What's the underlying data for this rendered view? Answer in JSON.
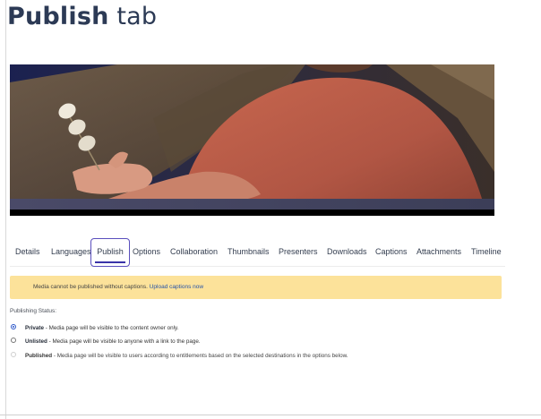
{
  "page": {
    "heading_bold": "Publish",
    "heading_rest": " tab"
  },
  "video": {
    "description_icon": "video-thumbnail"
  },
  "tabs": [
    {
      "label": "Details",
      "active": false
    },
    {
      "label": "Languages",
      "active": false
    },
    {
      "label": "Publish",
      "active": true
    },
    {
      "label": "Options",
      "active": false
    },
    {
      "label": "Collaboration",
      "active": false
    },
    {
      "label": "Thumbnails",
      "active": false
    },
    {
      "label": "Presenters",
      "active": false
    },
    {
      "label": "Downloads",
      "active": false
    },
    {
      "label": "Captions",
      "active": false
    },
    {
      "label": "Attachments",
      "active": false
    },
    {
      "label": "Timeline",
      "active": false
    }
  ],
  "alert": {
    "message": "Media cannot be published without captions.",
    "link_text": "Upload captions now",
    "color": "#fce29a"
  },
  "publishing": {
    "label": "Publishing Status:",
    "options": [
      {
        "name": "Private",
        "description": " - Media page will be visible to the content owner only.",
        "checked": true,
        "disabled": false
      },
      {
        "name": "Unlisted",
        "description": " - Media page will be visible to anyone with a link to the page.",
        "checked": false,
        "disabled": false
      },
      {
        "name": "Published",
        "description": " - Media page will be visible to users according to entitlements based on the selected destinations in the options below.",
        "checked": false,
        "disabled": true
      }
    ]
  },
  "colors": {
    "heading": "#2c3a55",
    "active_tab_border": "#5a4fbd",
    "radio_checked": "#2c57c9"
  }
}
